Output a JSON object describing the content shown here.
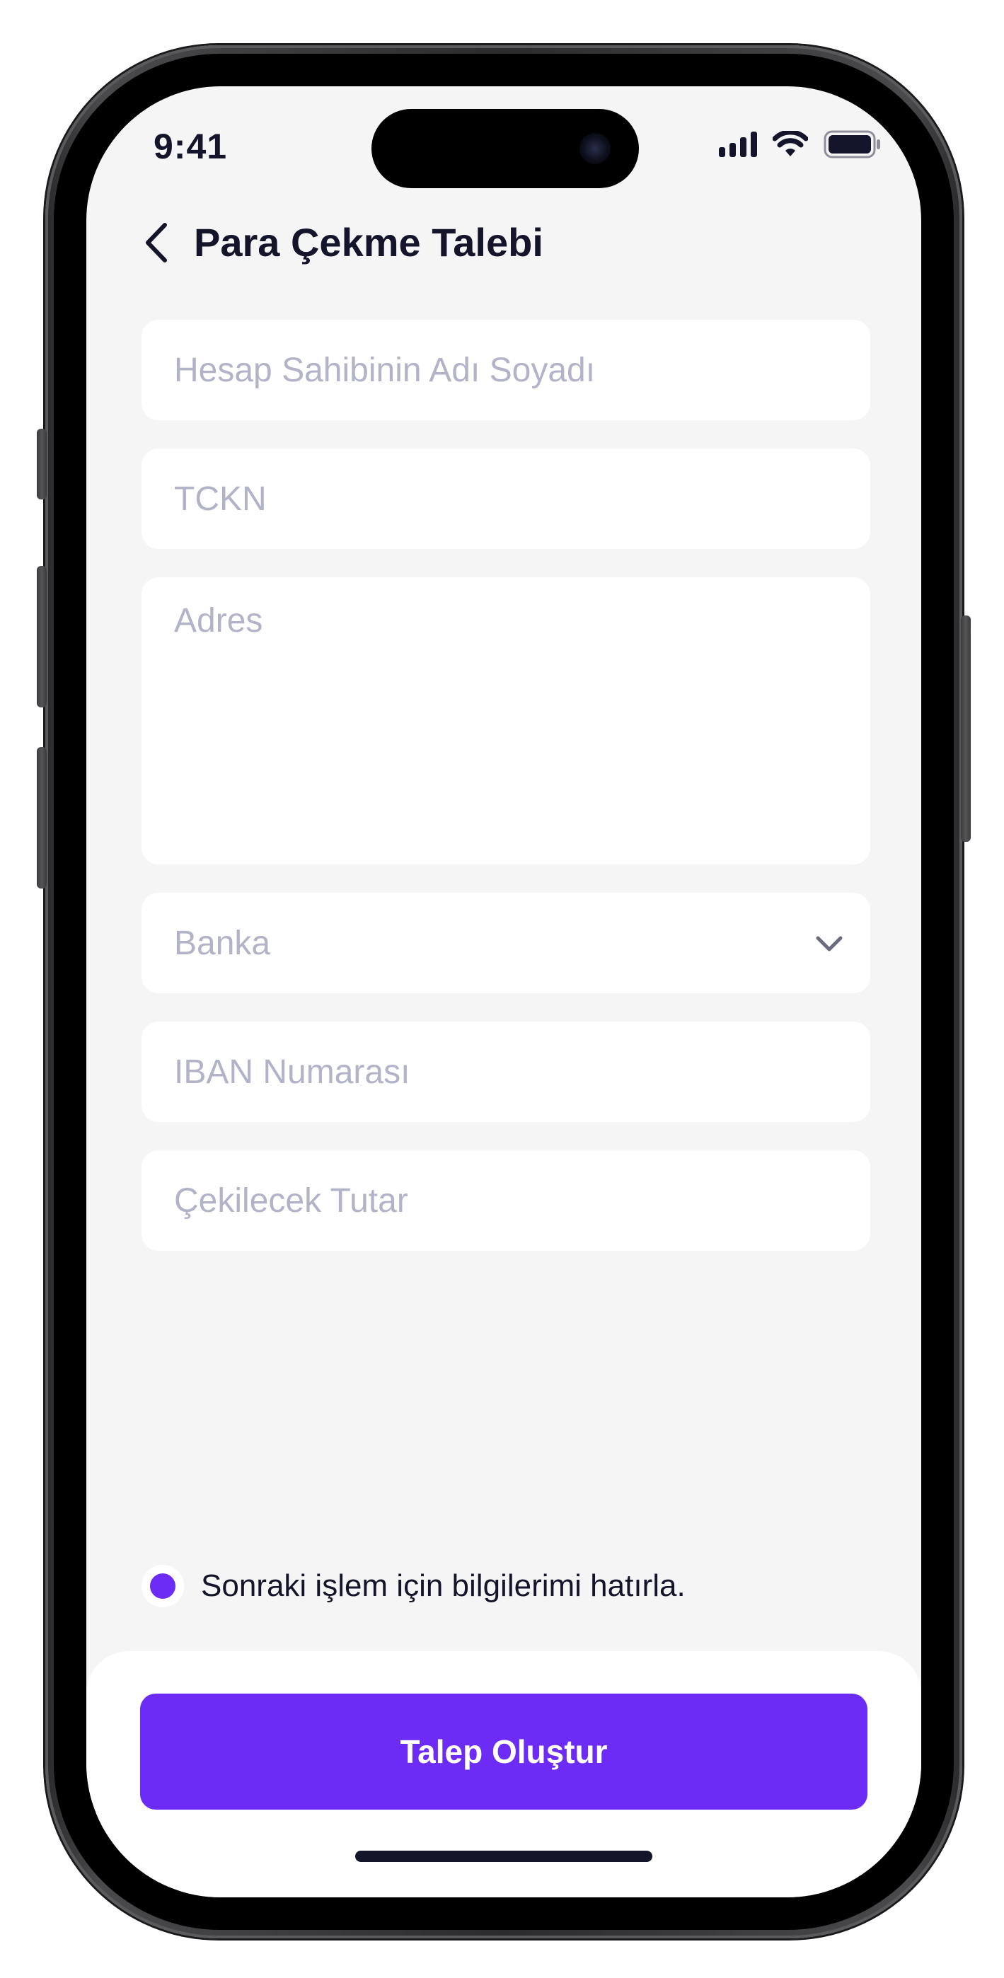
{
  "status_bar": {
    "time": "9:41",
    "signal_icon": "cellular-signal-icon",
    "wifi_icon": "wifi-icon",
    "battery_icon": "battery-icon"
  },
  "header": {
    "back_icon": "chevron-left-icon",
    "title": "Para Çekme Talebi"
  },
  "form": {
    "account_holder": {
      "placeholder": "Hesap Sahibinin Adı Soyadı",
      "value": ""
    },
    "tckn": {
      "placeholder": "TCKN",
      "value": ""
    },
    "address": {
      "placeholder": "Adres",
      "value": ""
    },
    "bank": {
      "placeholder": "Banka",
      "icon": "chevron-down-icon"
    },
    "iban": {
      "placeholder": "IBAN Numarası",
      "value": ""
    },
    "amount": {
      "placeholder": "Çekilecek Tutar",
      "value": ""
    }
  },
  "remember": {
    "label": "Sonraki işlem için bilgilerimi hatırla.",
    "selected": true
  },
  "cta": {
    "label": "Talep Oluştur"
  },
  "colors": {
    "accent": "#6c2cf5",
    "text": "#14142b",
    "placeholder": "#b2b2c8",
    "background": "#f5f5f6",
    "field": "#ffffff"
  }
}
